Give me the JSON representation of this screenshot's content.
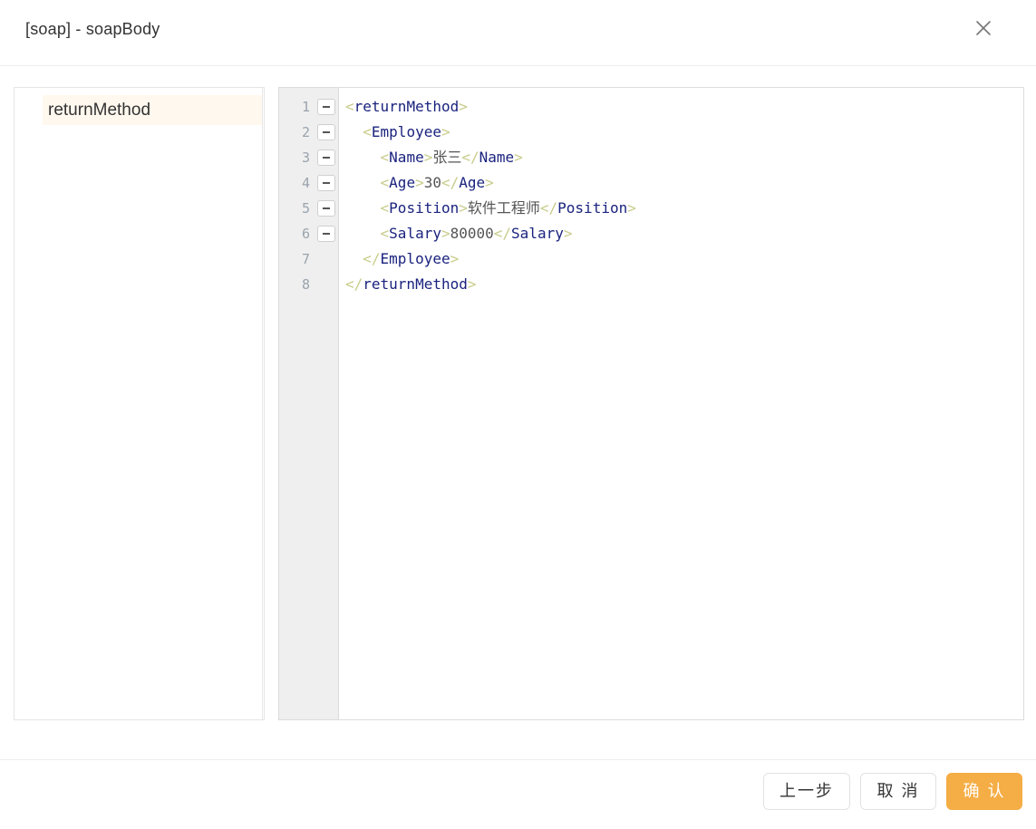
{
  "dialog": {
    "title": "[soap] - soapBody"
  },
  "tree": {
    "nodes": [
      {
        "label": "returnMethod",
        "selected": true
      }
    ]
  },
  "editor": {
    "language": "xml",
    "lines": [
      {
        "num": "1",
        "foldable": true,
        "indent": "",
        "parts": [
          {
            "t": "br",
            "v": "<"
          },
          {
            "t": "tag",
            "v": "returnMethod"
          },
          {
            "t": "br",
            "v": ">"
          }
        ]
      },
      {
        "num": "2",
        "foldable": true,
        "indent": "  ",
        "parts": [
          {
            "t": "br",
            "v": "<"
          },
          {
            "t": "tag",
            "v": "Employee"
          },
          {
            "t": "br",
            "v": ">"
          }
        ]
      },
      {
        "num": "3",
        "foldable": true,
        "indent": "    ",
        "parts": [
          {
            "t": "br",
            "v": "<"
          },
          {
            "t": "tag",
            "v": "Name"
          },
          {
            "t": "br",
            "v": ">"
          },
          {
            "t": "txt",
            "v": "张三"
          },
          {
            "t": "br",
            "v": "</"
          },
          {
            "t": "tag",
            "v": "Name"
          },
          {
            "t": "br",
            "v": ">"
          }
        ]
      },
      {
        "num": "4",
        "foldable": true,
        "indent": "    ",
        "parts": [
          {
            "t": "br",
            "v": "<"
          },
          {
            "t": "tag",
            "v": "Age"
          },
          {
            "t": "br",
            "v": ">"
          },
          {
            "t": "txt",
            "v": "30"
          },
          {
            "t": "br",
            "v": "</"
          },
          {
            "t": "tag",
            "v": "Age"
          },
          {
            "t": "br",
            "v": ">"
          }
        ]
      },
      {
        "num": "5",
        "foldable": true,
        "indent": "    ",
        "parts": [
          {
            "t": "br",
            "v": "<"
          },
          {
            "t": "tag",
            "v": "Position"
          },
          {
            "t": "br",
            "v": ">"
          },
          {
            "t": "txt",
            "v": "软件工程师"
          },
          {
            "t": "br",
            "v": "</"
          },
          {
            "t": "tag",
            "v": "Position"
          },
          {
            "t": "br",
            "v": ">"
          }
        ]
      },
      {
        "num": "6",
        "foldable": true,
        "indent": "    ",
        "parts": [
          {
            "t": "br",
            "v": "<"
          },
          {
            "t": "tag",
            "v": "Salary"
          },
          {
            "t": "br",
            "v": ">"
          },
          {
            "t": "txt",
            "v": "80000"
          },
          {
            "t": "br",
            "v": "</"
          },
          {
            "t": "tag",
            "v": "Salary"
          },
          {
            "t": "br",
            "v": ">"
          }
        ]
      },
      {
        "num": "7",
        "foldable": false,
        "indent": "  ",
        "parts": [
          {
            "t": "br",
            "v": "</"
          },
          {
            "t": "tag",
            "v": "Employee"
          },
          {
            "t": "br",
            "v": ">"
          }
        ]
      },
      {
        "num": "8",
        "foldable": false,
        "indent": "",
        "parts": [
          {
            "t": "br",
            "v": "</"
          },
          {
            "t": "tag",
            "v": "returnMethod"
          },
          {
            "t": "br",
            "v": ">"
          }
        ]
      }
    ]
  },
  "footer": {
    "prev_label": "上一步",
    "cancel_label": "取 消",
    "confirm_label": "确 认"
  },
  "colors": {
    "accent": "#f5ad45",
    "selected_bg": "#fff8ee",
    "xml_tag": "#1a237e",
    "xml_bracket": "#c8cc8a"
  }
}
